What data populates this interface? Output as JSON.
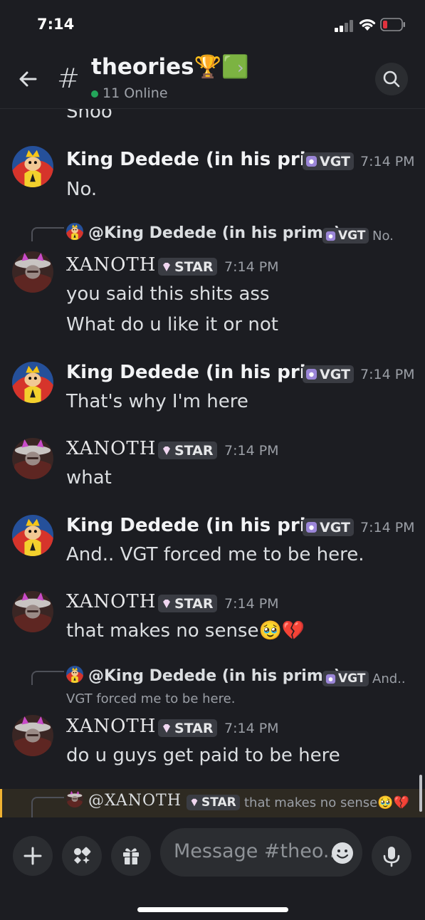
{
  "status_bar": {
    "time": "7:14"
  },
  "header": {
    "hash": "#",
    "channel_name": "theories🏆🟩",
    "chevron": "›",
    "online": "11 Online"
  },
  "messages": {
    "partial_top": "Shoo",
    "m1": {
      "author": "King Dedede (in his pri...",
      "tag": "VGT",
      "time": "7:14 PM",
      "lines": [
        "No."
      ]
    },
    "m2": {
      "reply_author": "@King Dedede (in his prime)",
      "reply_tag": "VGT",
      "reply_preview": "No.",
      "author": "XANOTH",
      "tag": "STAR",
      "time": "7:14 PM",
      "lines": [
        "you said this shits ass",
        "What do u like it or not"
      ]
    },
    "m3": {
      "author": "King Dedede (in his pri...",
      "tag": "VGT",
      "time": "7:14 PM",
      "lines": [
        "That's why I'm here"
      ]
    },
    "m4": {
      "author": "XANOTH",
      "tag": "STAR",
      "time": "7:14 PM",
      "lines": [
        "what"
      ]
    },
    "m5": {
      "author": "King Dedede (in his pri...",
      "tag": "VGT",
      "time": "7:14 PM",
      "lines": [
        "And..  VGT forced me to be here."
      ]
    },
    "m6": {
      "author": "XANOTH",
      "tag": "STAR",
      "time": "7:14 PM",
      "lines": [
        "that makes no sense🥹💔"
      ]
    },
    "m7": {
      "reply_author": "@King Dedede (in his prime)",
      "reply_tag": "VGT",
      "reply_preview": "And..",
      "reply_preview_line2": "VGT forced me to be here.",
      "author": "XANOTH",
      "tag": "STAR",
      "time": "7:14 PM",
      "lines": [
        "do u guys get paid to be here"
      ]
    },
    "m8_reply": {
      "reply_author": "@XANOTH",
      "reply_tag": "STAR",
      "reply_preview": "that makes no sense🥹💔"
    }
  },
  "composer": {
    "placeholder": "Message #theo..",
    "icons": [
      "plus-icon",
      "apps-icon",
      "gift-icon",
      "emoji-icon",
      "microphone-icon"
    ]
  },
  "colors": {
    "background": "#1c1d22",
    "online": "#23a55a",
    "battery_low": "#e0323e",
    "mention_highlight": "#f0b232"
  }
}
